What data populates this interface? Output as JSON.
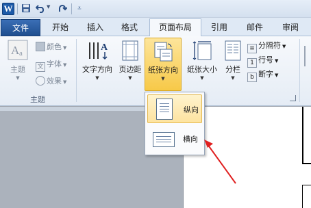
{
  "app": {
    "logo": "W"
  },
  "quick_access": {
    "save_icon": "save-icon",
    "undo_icon": "undo-icon",
    "redo_icon": "redo-icon",
    "customize_icon": "customize-qat-icon"
  },
  "tabs": {
    "file": "文件",
    "items": [
      "开始",
      "插入",
      "格式",
      "页面布局",
      "引用",
      "邮件",
      "审阅"
    ],
    "active": "页面布局"
  },
  "ribbon": {
    "theme_group": {
      "label": "主题",
      "themes_button": "主题",
      "colors": "颜色",
      "fonts": "字体",
      "effects": "效果"
    },
    "page_setup": {
      "text_direction": "文字方向",
      "margins": "页边距",
      "orientation": "纸张方向",
      "size": "纸张大小",
      "columns": "分栏",
      "breaks": "分隔符",
      "line_numbers": "行号",
      "hyphenation": "断字"
    }
  },
  "orientation_menu": {
    "portrait": "纵向",
    "landscape": "横向"
  },
  "colors": {
    "file_tab": "#2b5797",
    "highlight": "#fde59b",
    "annotation_arrow": "#e02020"
  }
}
